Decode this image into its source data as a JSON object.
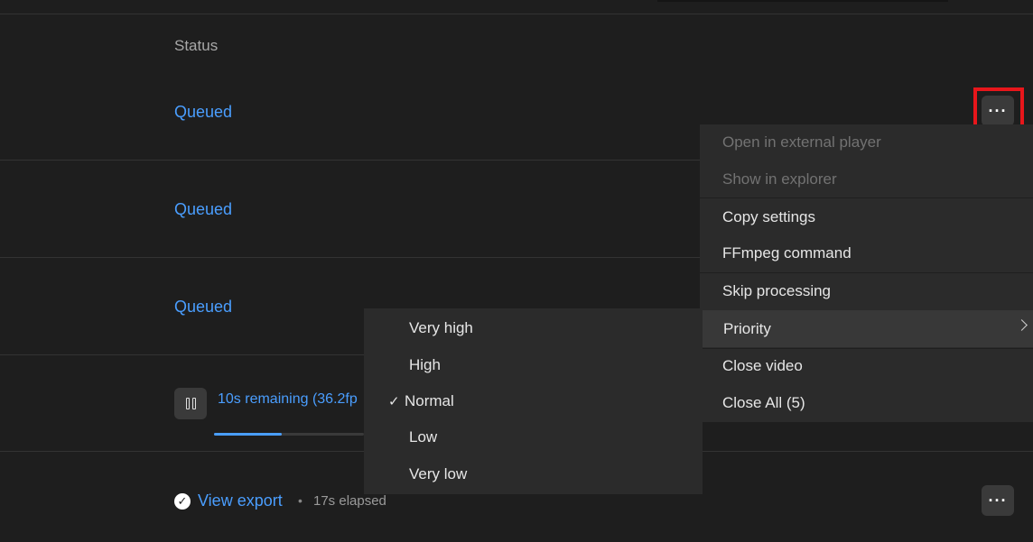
{
  "table": {
    "status_header": "Status",
    "rows": [
      {
        "status": "Queued"
      },
      {
        "status": "Queued"
      },
      {
        "status": "Queued"
      }
    ]
  },
  "active_job": {
    "remaining_text": "10s remaining (36.2fp",
    "progress_fraction": 0.45
  },
  "finished_job": {
    "link_label": "View export",
    "separator": "•",
    "elapsed": "17s elapsed"
  },
  "more_icon_glyph": "···",
  "context_menu": {
    "items": [
      {
        "label": "Open in external player",
        "disabled": true
      },
      {
        "label": "Show in explorer",
        "disabled": true
      },
      {
        "label": "Copy settings",
        "disabled": false
      },
      {
        "label": "FFmpeg command",
        "disabled": false
      },
      {
        "label": "Skip processing",
        "disabled": false
      },
      {
        "label": "Priority",
        "disabled": false,
        "submenu": true
      },
      {
        "label": "Close video",
        "disabled": false
      },
      {
        "label": "Close All (5)",
        "disabled": false
      }
    ]
  },
  "priority_submenu": {
    "items": [
      {
        "label": "Very high"
      },
      {
        "label": "High"
      },
      {
        "label": "Normal",
        "checked": true
      },
      {
        "label": "Low"
      },
      {
        "label": "Very low"
      }
    ],
    "check_glyph": "✓"
  },
  "colors": {
    "accent": "#4a9eff",
    "highlight": "#e8161b",
    "background": "#1e1e1e",
    "menu_bg": "#2b2b2b"
  }
}
